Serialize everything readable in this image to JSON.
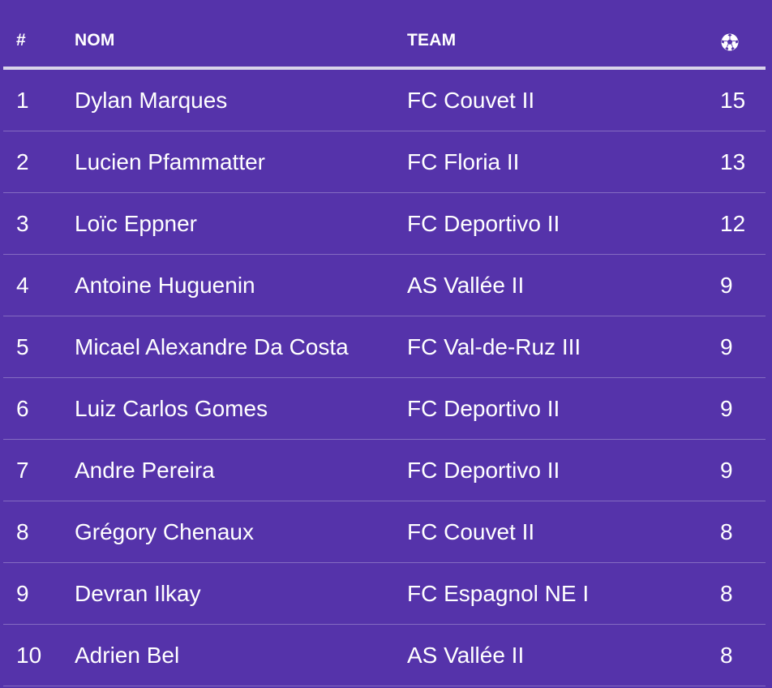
{
  "table": {
    "headers": {
      "rank": "#",
      "name": "NOM",
      "team": "TEAM",
      "goals_icon": "soccer-ball-icon"
    },
    "rows": [
      {
        "rank": "1",
        "name": "Dylan Marques",
        "team": "FC Couvet II",
        "goals": "15"
      },
      {
        "rank": "2",
        "name": "Lucien Pfammatter",
        "team": "FC Floria II",
        "goals": "13"
      },
      {
        "rank": "3",
        "name": "Loïc Eppner",
        "team": "FC Deportivo II",
        "goals": "12"
      },
      {
        "rank": "4",
        "name": "Antoine Huguenin",
        "team": "AS Vallée II",
        "goals": "9"
      },
      {
        "rank": "5",
        "name": "Micael Alexandre Da Costa",
        "team": "FC Val-de-Ruz III",
        "goals": "9"
      },
      {
        "rank": "6",
        "name": "Luiz Carlos Gomes",
        "team": "FC Deportivo II",
        "goals": "9"
      },
      {
        "rank": "7",
        "name": "Andre Pereira",
        "team": "FC Deportivo II",
        "goals": "9"
      },
      {
        "rank": "8",
        "name": "Grégory Chenaux",
        "team": "FC Couvet II",
        "goals": "8"
      },
      {
        "rank": "9",
        "name": "Devran Ilkay",
        "team": "FC Espagnol NE I",
        "goals": "8"
      },
      {
        "rank": "10",
        "name": "Adrien Bel",
        "team": "AS Vallée II",
        "goals": "8"
      }
    ]
  },
  "colors": {
    "background": "#5533aa",
    "text": "#ffffff",
    "header_rule": "#d9d4ea"
  }
}
